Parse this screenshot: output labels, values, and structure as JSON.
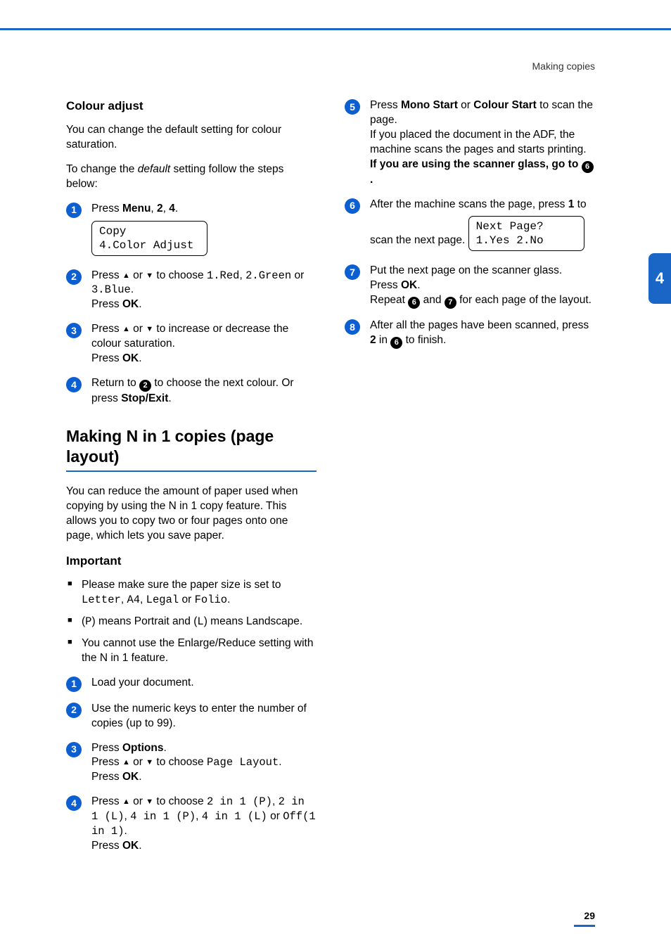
{
  "header": {
    "section_label": "Making copies"
  },
  "side_tab": "4",
  "page_number": "29",
  "colour_adjust": {
    "heading": "Colour adjust",
    "intro": "You can change the default setting for colour saturation.",
    "lead_pre": "To change the ",
    "lead_default": "default",
    "lead_post": " setting follow the steps below:",
    "step1": {
      "press": "Press ",
      "menu": "Menu",
      "sep1": ", ",
      "two": "2",
      "sep2": ", ",
      "four": "4",
      "dot": ".",
      "lcd_line1": "Copy",
      "lcd_line2": "4.Color Adjust"
    },
    "step2": {
      "pre": "Press ",
      "up": "▲",
      "or1": " or ",
      "down": "▼",
      "choose": " to choose ",
      "opt1": "1.Red",
      "c1": ", ",
      "opt2": "2.Green",
      "or2": " or ",
      "opt3": "3.Blue",
      "dot": ".",
      "press_line": "Press ",
      "ok": "OK",
      "dot2": "."
    },
    "step3": {
      "pre": "Press ",
      "up": "▲",
      "or1": " or ",
      "down": "▼",
      "rest": " to increase or decrease the colour saturation.",
      "press_line": "Press ",
      "ok": "OK",
      "dot": "."
    },
    "step4": {
      "pre": "Return to ",
      "ref": "2",
      "post": " to choose the next colour. Or press ",
      "stop": "Stop/Exit",
      "dot": "."
    }
  },
  "nin1": {
    "heading": "Making N in 1 copies (page layout)",
    "intro": "You can reduce the amount of paper used when copying by using the N in 1 copy feature. This allows you to copy two or four pages onto one page, which lets you save paper.",
    "important_heading": "Important",
    "b1_pre": "Please make sure the paper size is set to ",
    "b1_opt1": "Letter",
    "b1_c1": ", ",
    "b1_opt2": "A4",
    "b1_c2": ", ",
    "b1_opt3": "Legal",
    "b1_or": " or ",
    "b1_opt4": "Folio",
    "b1_dot": ".",
    "b2_lp": "(",
    "b2_p": "P",
    "b2_mid": ") means Portrait and (",
    "b2_l": "L",
    "b2_rp": ") means Landscape.",
    "b3": "You cannot use the Enlarge/Reduce setting with the N in 1 feature.",
    "s1": "Load your document.",
    "s2": "Use the numeric keys to enter the number of copies (up to 99).",
    "s3": {
      "press": "Press ",
      "options": "Options",
      "dot": ".",
      "pre": "Press ",
      "up": "▲",
      "or": " or ",
      "down": "▼",
      "choose": " to choose ",
      "pl": "Page Layout",
      "dot2": ".",
      "press2": "Press ",
      "ok": "OK",
      "dot3": "."
    },
    "s4": {
      "pre": "Press ",
      "up": "▲",
      "or": " or ",
      "down": "▼",
      "choose": " to choose ",
      "o1": "2 in 1 (P)",
      "c1": ", ",
      "o2": "2 in 1 (L)",
      "c2": ", ",
      "o3": "4 in 1 (P)",
      "c3": ", ",
      "o4": "4 in 1 (L)",
      "or2": " or ",
      "o5": "Off(1 in 1)",
      "dot": ".",
      "press2": "Press ",
      "ok": "OK",
      "dot2": "."
    },
    "s5": {
      "pre": "Press ",
      "mono": "Mono Start",
      "or": " or ",
      "colour": "Colour Start",
      "rest": " to scan the page.",
      "adf": "If you placed the document in the ADF, the machine scans the pages and starts printing.",
      "glass_pre": "If you are using the scanner glass, go to ",
      "ref": "6",
      "glass_post": "."
    },
    "s6": {
      "line1": "After the machine scans the page, press ",
      "one": "1",
      "line2": " to scan the next page.",
      "lcd_line1": "Next Page?",
      "lcd_line2": "1.Yes 2.No"
    },
    "s7": {
      "l1": "Put the next page on the scanner glass.",
      "press": "Press ",
      "ok": "OK",
      "dot": ".",
      "rep_pre": "Repeat ",
      "r1": "6",
      "rep_and": " and ",
      "r2": "7",
      "rep_post": " for each page of the layout."
    },
    "s8": {
      "pre": "After all the pages have been scanned, press ",
      "two": "2",
      "mid": " in ",
      "ref": "6",
      "post": " to finish."
    }
  }
}
